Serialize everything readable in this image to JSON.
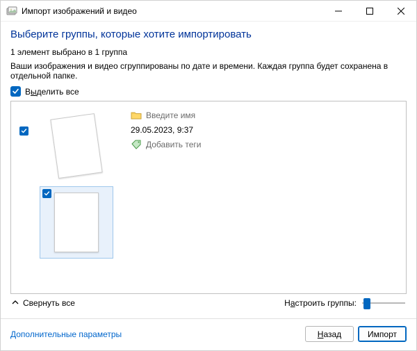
{
  "window": {
    "title": "Импорт изображений и видео"
  },
  "heading": "Выберите группы, которые хотите импортировать",
  "summary": "1 элемент выбрано в 1 группа",
  "description": "Ваши изображения и видео сгруппированы по дате и времени. Каждая группа будет сохранена в отдельной папке.",
  "select_all": {
    "prefix": "В",
    "hot": "ы",
    "suffix": "делить все",
    "checked": true
  },
  "group": {
    "checked": true,
    "name_placeholder": "Введите имя",
    "datetime": "29.05.2023, 9:37",
    "tags_placeholder": "Добавить теги",
    "items": [
      {
        "selected": false
      },
      {
        "selected": true
      }
    ]
  },
  "collapse_all": "Свернуть все",
  "adjust_groups": {
    "prefix": "Н",
    "hot": "а",
    "suffix": "строить группы:"
  },
  "more_options": "Дополнительные параметры",
  "buttons": {
    "back": {
      "hot": "Н",
      "rest": "азад"
    },
    "import": "Импорт"
  }
}
